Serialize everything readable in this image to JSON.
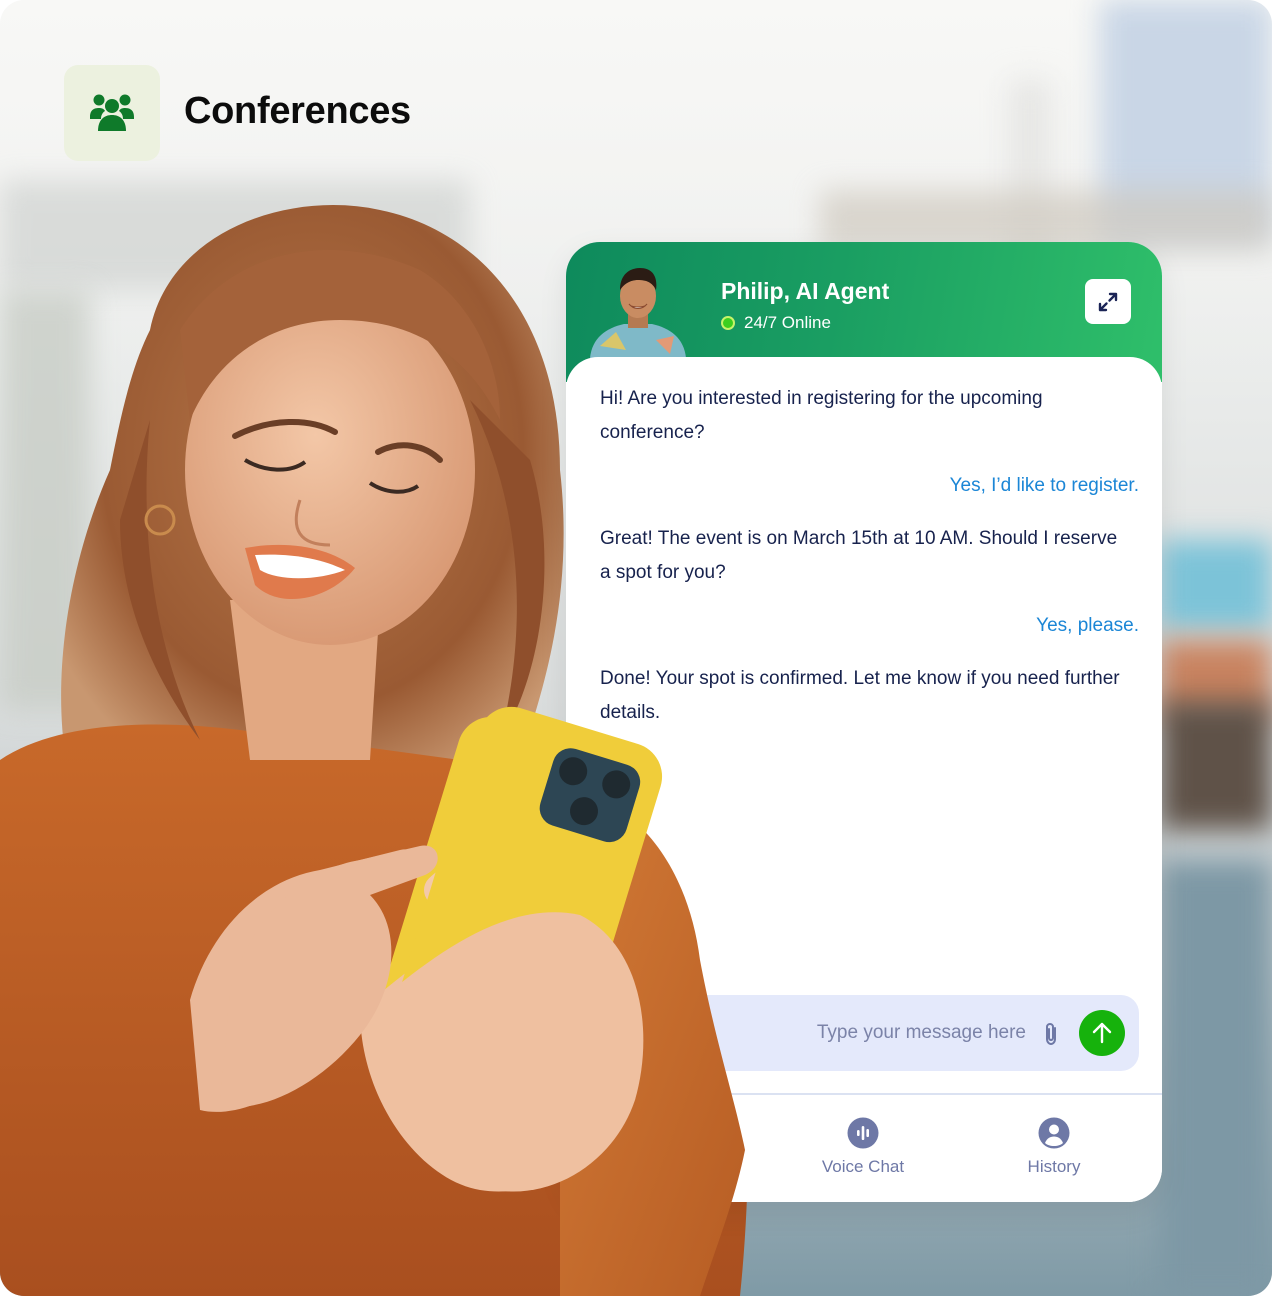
{
  "header": {
    "icon": "users-group-icon",
    "title": "Conferences"
  },
  "chat": {
    "agent": {
      "name": "Philip, AI Agent",
      "status": "24/7 Online",
      "status_color": "#3ccf1f"
    },
    "expand_icon": "expand-arrows-icon",
    "messages": [
      {
        "sender": "bot",
        "text": "Hi! Are you interested in registering for the upcoming conference?"
      },
      {
        "sender": "user",
        "text": "Yes, I’d like to register."
      },
      {
        "sender": "bot",
        "text": "Great! The event is on March 15th at 10 AM. Should I reserve a spot for you?"
      },
      {
        "sender": "user",
        "text": "Yes, please."
      },
      {
        "sender": "bot",
        "text": "Done! Your spot is confirmed. Let me know if you need further details."
      }
    ],
    "composer": {
      "placeholder": "Type your message here",
      "attach_icon": "paperclip-icon",
      "send_icon": "arrow-up-icon"
    },
    "nav": [
      {
        "label": "Voice Chat",
        "icon": "voice-wave-icon"
      },
      {
        "label": "History",
        "icon": "user-circle-icon"
      }
    ]
  },
  "colors": {
    "brand_green": "#0f7a2a",
    "header_gradient_start": "#0e8a5c",
    "header_gradient_end": "#2fbf6a",
    "bot_text": "#17224d",
    "user_text": "#1b86d6",
    "send_button": "#16b20c",
    "nav_text": "#6e78a6"
  }
}
